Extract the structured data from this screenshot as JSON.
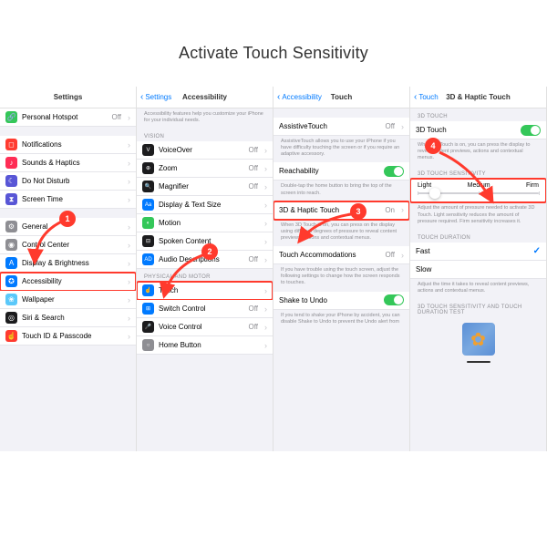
{
  "title": "Activate Touch Sensitivity",
  "panel1": {
    "header": "Settings",
    "rows": [
      {
        "icon": "🔗",
        "cls": "ic-green",
        "label": "Personal Hotspot",
        "value": "Off",
        "group": 0
      },
      {
        "icon": "◻",
        "cls": "ic-red",
        "label": "Notifications",
        "group": 1
      },
      {
        "icon": "♪",
        "cls": "ic-pink",
        "label": "Sounds & Haptics",
        "group": 1
      },
      {
        "icon": "☾",
        "cls": "ic-purple",
        "label": "Do Not Disturb",
        "group": 1
      },
      {
        "icon": "⧗",
        "cls": "ic-indigo",
        "label": "Screen Time",
        "group": 1
      },
      {
        "icon": "⚙",
        "cls": "ic-gray",
        "label": "General",
        "group": 2
      },
      {
        "icon": "◉",
        "cls": "ic-gray",
        "label": "Control Center",
        "group": 2
      },
      {
        "icon": "A",
        "cls": "ic-blue",
        "label": "Display & Brightness",
        "group": 2
      },
      {
        "icon": "✪",
        "cls": "ic-blue",
        "label": "Accessibility",
        "group": 2,
        "highlight": true
      },
      {
        "icon": "❀",
        "cls": "ic-teal",
        "label": "Wallpaper",
        "group": 2
      },
      {
        "icon": "◎",
        "cls": "ic-black",
        "label": "Siri & Search",
        "group": 2
      },
      {
        "icon": "☝",
        "cls": "ic-red",
        "label": "Touch ID & Passcode",
        "group": 2
      }
    ]
  },
  "panel2": {
    "back": "Settings",
    "header": "Accessibility",
    "intro": "Accessibility features help you customize your iPhone for your individual needs.",
    "section1": "VISION",
    "rows1": [
      {
        "icon": "V",
        "cls": "ic-black",
        "label": "VoiceOver",
        "value": "Off"
      },
      {
        "icon": "⊕",
        "cls": "ic-black",
        "label": "Zoom",
        "value": "Off"
      },
      {
        "icon": "🔍",
        "cls": "ic-black",
        "label": "Magnifier",
        "value": "Off"
      },
      {
        "icon": "Aa",
        "cls": "ic-blue",
        "label": "Display & Text Size"
      },
      {
        "icon": "◐",
        "cls": "ic-green",
        "label": "Motion"
      },
      {
        "icon": "⊟",
        "cls": "ic-black",
        "label": "Spoken Content"
      },
      {
        "icon": "AD",
        "cls": "ic-blue",
        "label": "Audio Descriptions",
        "value": "Off"
      }
    ],
    "section2": "PHYSICAL AND MOTOR",
    "rows2": [
      {
        "icon": "☝",
        "cls": "ic-blue",
        "label": "Touch",
        "highlight": true
      },
      {
        "icon": "⊞",
        "cls": "ic-blue",
        "label": "Switch Control",
        "value": "Off"
      },
      {
        "icon": "🎤",
        "cls": "ic-black",
        "label": "Voice Control",
        "value": "Off"
      },
      {
        "icon": "○",
        "cls": "ic-gray",
        "label": "Home Button"
      }
    ]
  },
  "panel3": {
    "back": "Accessibility",
    "header": "Touch",
    "rows": [
      {
        "label": "AssistiveTouch",
        "value": "Off",
        "desc": "AssistiveTouch allows you to use your iPhone if you have difficulty touching the screen or if you require an adaptive accessory."
      },
      {
        "label": "Reachability",
        "toggle": "on",
        "desc": "Double-tap the home button to bring the top of the screen into reach."
      },
      {
        "label": "3D & Haptic Touch",
        "value": "On",
        "highlight": true,
        "desc": "When 3D Touch is on, you can press on the display using different degrees of pressure to reveal content previews, actions and contextual menus."
      },
      {
        "label": "Touch Accommodations",
        "value": "Off",
        "desc": "If you have trouble using the touch screen, adjust the following settings to change how the screen responds to touches."
      },
      {
        "label": "Shake to Undo",
        "toggle": "on",
        "desc": "If you tend to shake your iPhone by accident, you can disable Shake to Undo to prevent the Undo alert from"
      }
    ]
  },
  "panel4": {
    "back": "Touch",
    "header": "3D & Haptic Touch",
    "section1": "3D TOUCH",
    "row1": {
      "label": "3D Touch",
      "toggle": "on"
    },
    "desc1": "When 3D Touch is on, you can press the display to reveal content previews, actions and contextual menus.",
    "section2": "3D TOUCH SENSITIVITY",
    "slider": {
      "labels": [
        "Light",
        "Medium",
        "Firm"
      ],
      "pos": 10
    },
    "desc2": "Adjust the amount of pressure needed to activate 3D Touch. Light sensitivity reduces the amount of pressure required. Firm sensitivity increases it.",
    "section3": "TOUCH DURATION",
    "rows3": [
      {
        "label": "Fast",
        "checked": true
      },
      {
        "label": "Slow"
      }
    ],
    "desc3": "Adjust the time it takes to reveal content previews, actions and contextual menus.",
    "section4": "3D TOUCH SENSITIVITY AND TOUCH DURATION TEST"
  },
  "badges": [
    "1",
    "2",
    "3",
    "4"
  ]
}
